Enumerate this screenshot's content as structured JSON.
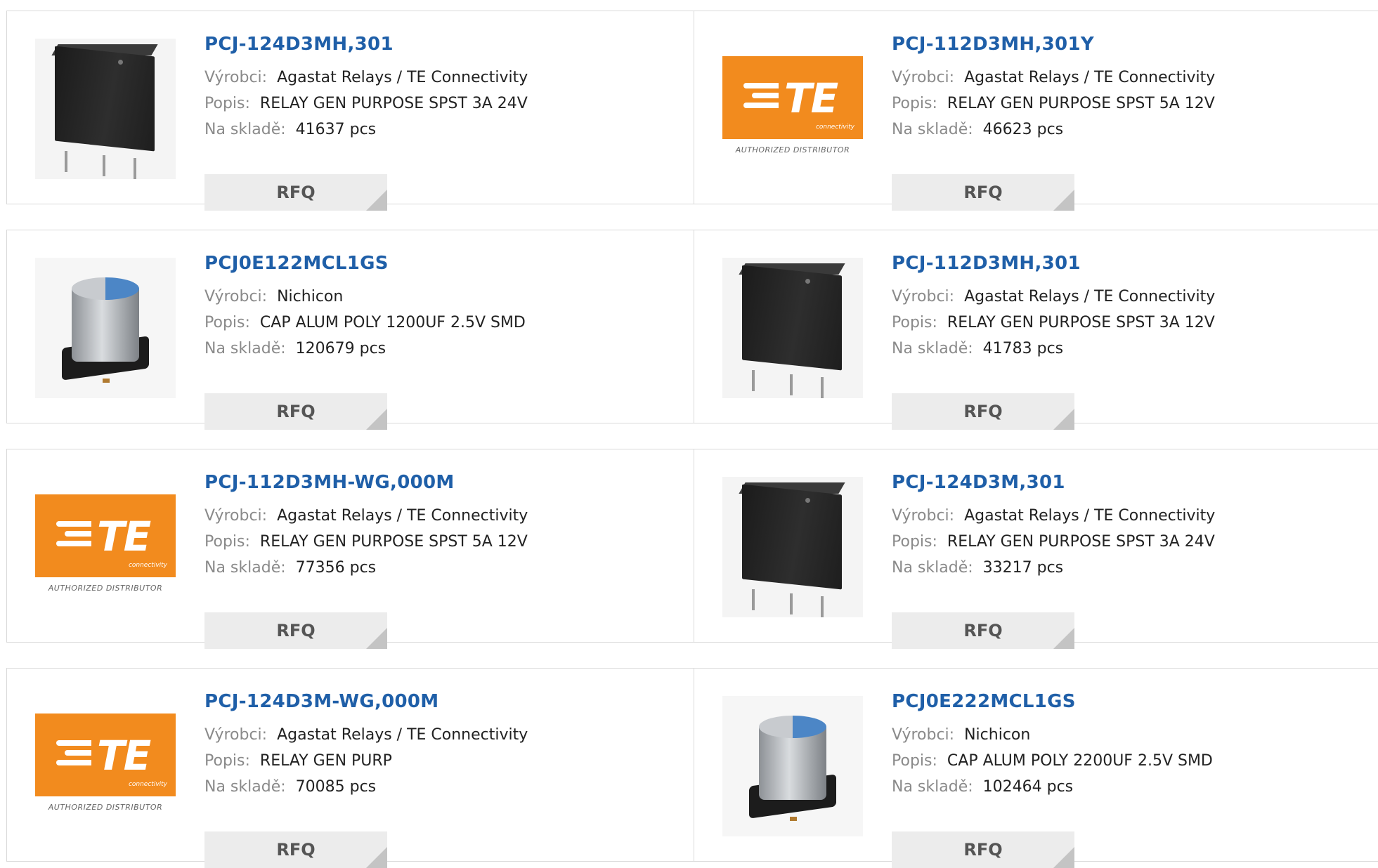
{
  "labels": {
    "manufacturer": "Výrobci:",
    "description": "Popis:",
    "stock": "Na skladě:",
    "rfq": "RFQ"
  },
  "logo": {
    "te_letters": "TE",
    "te_sub": "connectivity",
    "authorized": "AUTHORIZED DISTRIBUTOR",
    "brand_color": "#f28b1e"
  },
  "colors": {
    "part_link": "#1f5fa8",
    "label_gray": "#8a8a8a",
    "rfq_bg": "#ececec"
  },
  "products": [
    {
      "part": "PCJ-124D3MH,301",
      "manufacturer": "Agastat Relays / TE Connectivity",
      "description": "RELAY GEN PURPOSE SPST 3A 24V",
      "stock": "41637 pcs",
      "image": "relay-image"
    },
    {
      "part": "PCJ-112D3MH,301Y",
      "manufacturer": "Agastat Relays / TE Connectivity",
      "description": "RELAY GEN PURPOSE SPST 5A 12V",
      "stock": "46623 pcs",
      "image": "te-logo"
    },
    {
      "part": "PCJ0E122MCL1GS",
      "manufacturer": "Nichicon",
      "description": "CAP ALUM POLY 1200UF 2.5V SMD",
      "stock": "120679 pcs",
      "image": "capacitor-image"
    },
    {
      "part": "PCJ-112D3MH,301",
      "manufacturer": "Agastat Relays / TE Connectivity",
      "description": "RELAY GEN PURPOSE SPST 3A 12V",
      "stock": "41783 pcs",
      "image": "relay-image"
    },
    {
      "part": "PCJ-112D3MH-WG,000M",
      "manufacturer": "Agastat Relays / TE Connectivity",
      "description": "RELAY GEN PURPOSE SPST 5A 12V",
      "stock": "77356 pcs",
      "image": "te-logo"
    },
    {
      "part": "PCJ-124D3M,301",
      "manufacturer": "Agastat Relays / TE Connectivity",
      "description": "RELAY GEN PURPOSE SPST 3A 24V",
      "stock": "33217 pcs",
      "image": "relay-image"
    },
    {
      "part": "PCJ-124D3M-WG,000M",
      "manufacturer": "Agastat Relays / TE Connectivity",
      "description": "RELAY GEN PURP",
      "stock": "70085 pcs",
      "image": "te-logo"
    },
    {
      "part": "PCJ0E222MCL1GS",
      "manufacturer": "Nichicon",
      "description": "CAP ALUM POLY 2200UF 2.5V SMD",
      "stock": "102464 pcs",
      "image": "capacitor-image"
    }
  ]
}
